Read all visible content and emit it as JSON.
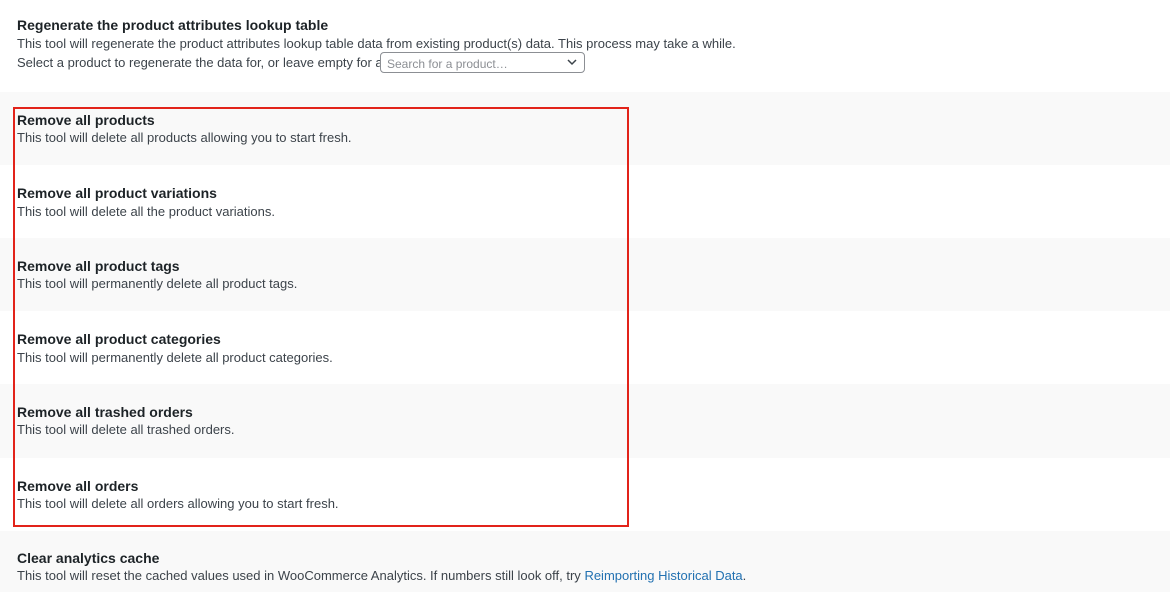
{
  "regenerate": {
    "title": "Regenerate the product attributes lookup table",
    "description": "This tool will regenerate the product attributes lookup table data from existing product(s) data. This process may take a while.",
    "select_label": "Select a product to regenerate the data for, or leave empty for a full table regeneration:",
    "search_placeholder": "Search for a product…"
  },
  "tools": [
    {
      "title": "Remove all products",
      "description": "This tool will delete all products allowing you to start fresh."
    },
    {
      "title": "Remove all product variations",
      "description": "This tool will delete all the product variations."
    },
    {
      "title": "Remove all product tags",
      "description": "This tool will permanently delete all product tags."
    },
    {
      "title": "Remove all product categories",
      "description": "This tool will permanently delete all product categories."
    },
    {
      "title": "Remove all trashed orders",
      "description": "This tool will delete all trashed orders."
    },
    {
      "title": "Remove all orders",
      "description": "This tool will delete all orders allowing you to start fresh."
    }
  ],
  "analytics": {
    "title": "Clear analytics cache",
    "description_prefix": "This tool will reset the cached values used in WooCommerce Analytics. If numbers still look off, try ",
    "link_text": "Reimporting Historical Data",
    "description_suffix": "."
  },
  "colors": {
    "highlight": "#e2231a",
    "link": "#2271b1",
    "alt_row": "#f9f9f9"
  }
}
